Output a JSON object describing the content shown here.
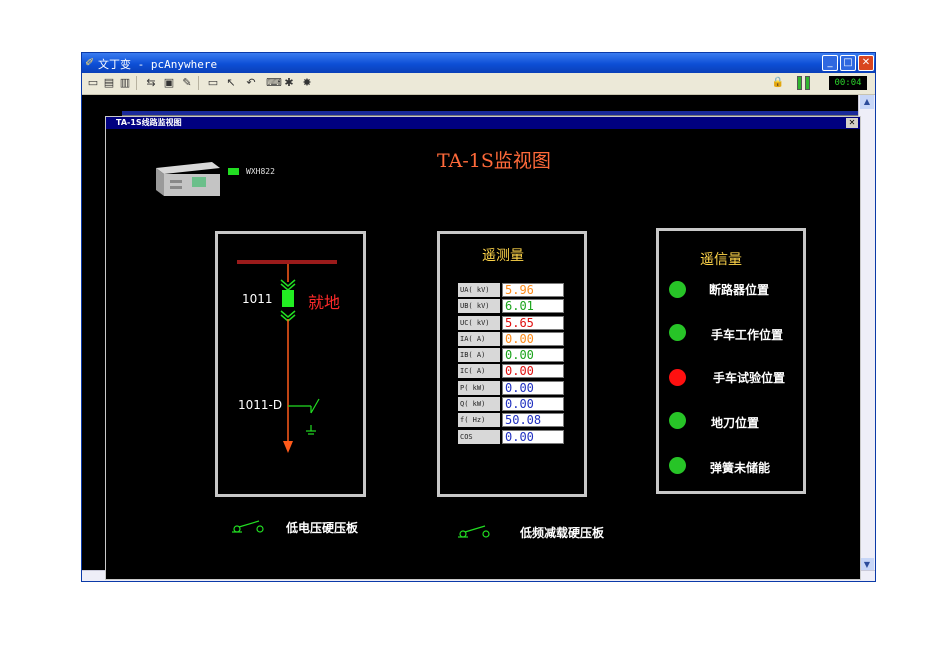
{
  "window": {
    "title": "文丁变 - pcAnywhere",
    "timer": "00:04"
  },
  "inner_window": {
    "title": "TA-1S线路监视图"
  },
  "diagram": {
    "main_title": "TA-1S监视图",
    "device_label": "WXH822",
    "switch_1011": "1011",
    "switch_1011_D": "1011-D",
    "local_text": "就地"
  },
  "telemetry": {
    "title": "遥测量",
    "rows": [
      {
        "label": "UA( kV)",
        "value": "5.96",
        "color": "#ff8c1a"
      },
      {
        "label": "UB( kV)",
        "value": "6.01",
        "color": "#1aa31a"
      },
      {
        "label": "UC( kV)",
        "value": "5.65",
        "color": "#e01010"
      },
      {
        "label": "IA( A)",
        "value": "0.00",
        "color": "#ff8c1a"
      },
      {
        "label": "IB( A)",
        "value": "0.00",
        "color": "#1aa31a"
      },
      {
        "label": "IC( A)",
        "value": "0.00",
        "color": "#e01010"
      },
      {
        "label": "P( kW)",
        "value": "0.00",
        "color": "#2030c0"
      },
      {
        "label": "Q( kW)",
        "value": "0.00",
        "color": "#2030c0"
      },
      {
        "label": "f( Hz)",
        "value": "50.08",
        "color": "#2030c0"
      },
      {
        "label": "COS",
        "value": "0.00",
        "color": "#2030c0"
      }
    ]
  },
  "telesignal": {
    "title": "遥信量",
    "items": [
      {
        "label": "断路器位置",
        "state_color": "#27c427"
      },
      {
        "label": "手车工作位置",
        "state_color": "#27c427"
      },
      {
        "label": "手车试验位置",
        "state_color": "#ff1010"
      },
      {
        "label": "地刀位置",
        "state_color": "#27c427"
      },
      {
        "label": "弹簧未储能",
        "state_color": "#27c427"
      }
    ]
  },
  "hard_plates": [
    {
      "label": "低电压硬压板"
    },
    {
      "label": "低频减载硬压板"
    }
  ]
}
